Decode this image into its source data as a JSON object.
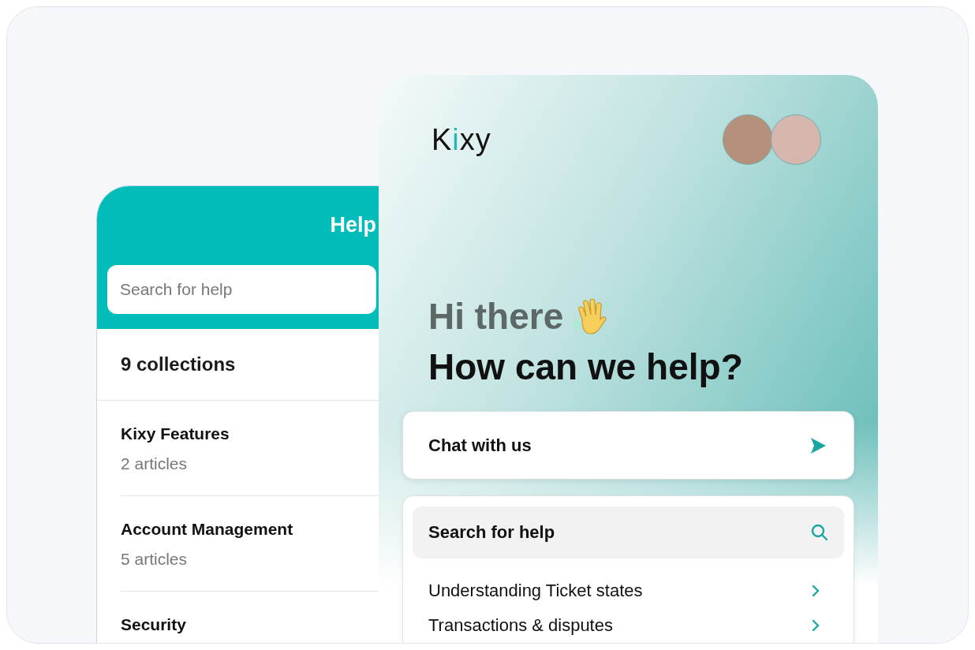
{
  "help_panel": {
    "title": "Help",
    "search": {
      "placeholder": "Search for help"
    },
    "collections_count": "9 collections",
    "collections": [
      {
        "name": "Kixy Features",
        "count": "2 articles"
      },
      {
        "name": "Account Management",
        "count": "5 articles"
      },
      {
        "name": "Security"
      }
    ]
  },
  "messenger": {
    "logo": "Kixy",
    "greeting": "Hi there",
    "headline": "How can we help?",
    "chat_button": "Chat with us",
    "search": {
      "label": "Search for help"
    },
    "articles": [
      "Understanding Ticket states",
      "Transactions & disputes"
    ]
  }
}
